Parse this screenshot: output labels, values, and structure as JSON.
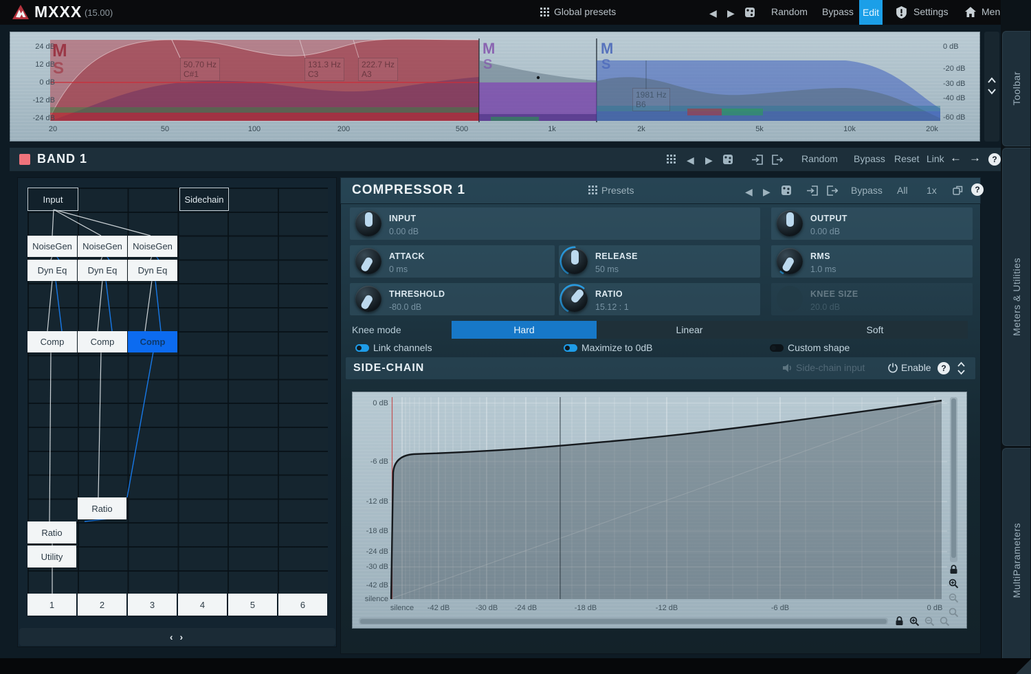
{
  "topbar": {
    "logo": "MXXX",
    "version": "(15.00)",
    "global_presets": "Global presets",
    "random": "Random",
    "bypass": "Bypass",
    "edit": "Edit",
    "settings": "Settings",
    "menu": "Menu"
  },
  "spectrum": {
    "db_left": [
      "24 dB",
      "12 dB",
      "0 dB",
      "-12 dB",
      "-24 dB"
    ],
    "db_right": [
      "0 dB",
      "-20 dB",
      "-30 dB",
      "-40 dB",
      "-60 dB"
    ],
    "freq": [
      "20",
      "50",
      "100",
      "200",
      "500",
      "1k",
      "2k",
      "5k",
      "10k",
      "20k"
    ],
    "markers": [
      {
        "hz": "50.70 Hz",
        "note": "C#1"
      },
      {
        "hz": "131.3 Hz",
        "note": "C3"
      },
      {
        "hz": "222.7 Hz",
        "note": "A3"
      },
      {
        "hz": "1981 Hz",
        "note": "B6"
      }
    ],
    "ms": {
      "m": "M",
      "s": "S"
    }
  },
  "band": {
    "title": "BAND 1",
    "random": "Random",
    "bypass": "Bypass",
    "reset": "Reset",
    "link": "Link"
  },
  "matrix": {
    "input": "Input",
    "sidechain": "Sidechain",
    "noisegen": "NoiseGen",
    "dyneq": "Dyn Eq",
    "comp": "Comp",
    "ratio": "Ratio",
    "utility": "Utility",
    "outputs": [
      "1",
      "2",
      "3",
      "4",
      "5",
      "6"
    ],
    "nav": "‹ ›"
  },
  "compressor": {
    "title": "COMPRESSOR 1",
    "presets": "Presets",
    "bypass": "Bypass",
    "all": "All",
    "scale": "1x",
    "knobs": [
      {
        "label": "INPUT",
        "value": "0.00 dB"
      },
      {
        "label": "OUTPUT",
        "value": "0.00 dB"
      },
      {
        "label": "ATTACK",
        "value": "0 ms"
      },
      {
        "label": "RELEASE",
        "value": "50 ms"
      },
      {
        "label": "RMS",
        "value": "1.0 ms"
      },
      {
        "label": "THRESHOLD",
        "value": "-80.0 dB"
      },
      {
        "label": "RATIO",
        "value": "15.12 : 1"
      },
      {
        "label": "KNEE SIZE",
        "value": "20.0 dB"
      }
    ],
    "knee_label": "Knee mode",
    "knee_modes": [
      "Hard",
      "Linear",
      "Soft"
    ],
    "knee_selected": "Hard",
    "toggles": [
      {
        "label": "Link channels",
        "on": true
      },
      {
        "label": "Maximize to 0dB",
        "on": true
      },
      {
        "label": "Custom shape",
        "on": false
      }
    ]
  },
  "sidechain": {
    "title": "SIDE-CHAIN",
    "input_label": "Side-chain input",
    "enable": "Enable",
    "graph": {
      "y_labels": [
        "0 dB",
        "-6 dB",
        "-12 dB",
        "-18 dB",
        "-24 dB",
        "-30 dB",
        "-42 dB",
        "silence"
      ],
      "x_labels": [
        "silence",
        "-42 dB",
        "-30 dB",
        "-24 dB",
        "-18 dB",
        "-12 dB",
        "-6 dB",
        "0 dB"
      ]
    }
  },
  "side_tabs": [
    "Toolbar",
    "Meters & Utilities",
    "MultiParameters"
  ],
  "colors": {
    "accent": "#1b9fe8",
    "band_color": "#f0737b",
    "node_selected": "#0c6bf0"
  }
}
